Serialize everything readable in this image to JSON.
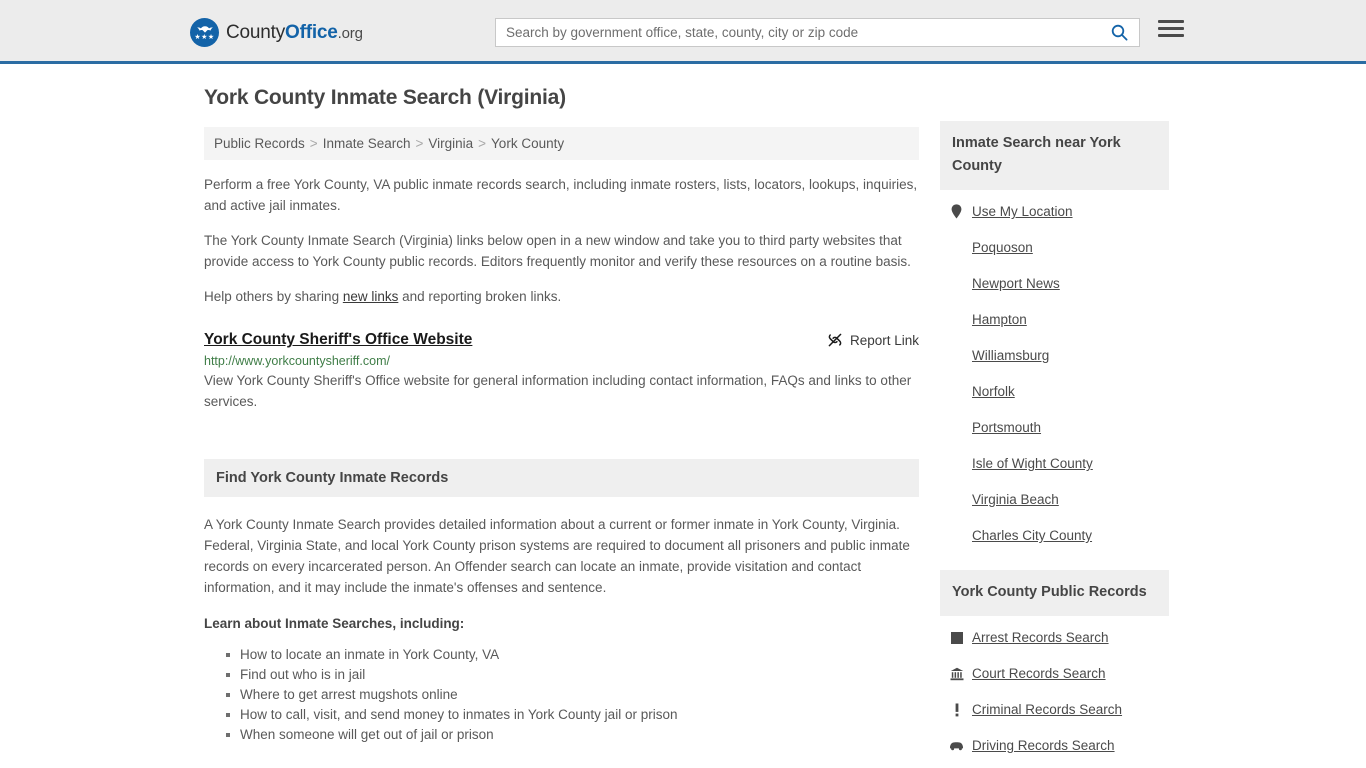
{
  "header": {
    "brand": {
      "part1": "County",
      "part2": "Office",
      "part3": ".org"
    },
    "search": {
      "placeholder": "Search by government office, state, county, city or zip code",
      "value": ""
    },
    "search_icon": "search-icon",
    "menu_icon": "hamburger-menu-icon"
  },
  "page": {
    "title": "York County Inmate Search (Virginia)"
  },
  "breadcrumb": {
    "items": [
      {
        "label": "Public Records"
      },
      {
        "label": "Inmate Search"
      },
      {
        "label": "Virginia"
      },
      {
        "label": "York County"
      }
    ],
    "separator": ">"
  },
  "intro": {
    "p1": "Perform a free York County, VA public inmate records search, including inmate rosters, lists, locators, lookups, inquiries, and active jail inmates.",
    "p2": "The York County Inmate Search (Virginia) links below open in a new window and take you to third party websites that provide access to York County public records. Editors frequently monitor and verify these resources on a routine basis.",
    "p3_before": "Help others by sharing ",
    "p3_link": "new links",
    "p3_after": " and reporting broken links."
  },
  "result": {
    "title": "York County Sheriff's Office Website",
    "url": "http://www.yorkcountysheriff.com/",
    "description": "View York County Sheriff's Office website for general information including contact information, FAQs and links to other services.",
    "report_label": "Report Link",
    "report_icon": "broken-link-icon"
  },
  "section": {
    "heading": "Find York County Inmate Records",
    "body": "A York County Inmate Search provides detailed information about a current or former inmate in York County, Virginia. Federal, Virginia State, and local York County prison systems are required to document all prisoners and public inmate records on every incarcerated person. An Offender search can locate an inmate, provide visitation and contact information, and it may include the inmate's offenses and sentence.",
    "subheading": "Learn about Inmate Searches, including:",
    "bullets": [
      "How to locate an inmate in York County, VA",
      "Find out who is in jail",
      "Where to get arrest mugshots online",
      "How to call, visit, and send money to inmates in York County jail or prison",
      "When someone will get out of jail or prison"
    ]
  },
  "sidebar": {
    "nearby": {
      "heading": "Inmate Search near York County",
      "items": [
        {
          "label": "Use My Location",
          "icon": "map-pin-icon"
        },
        {
          "label": "Poquoson",
          "icon": ""
        },
        {
          "label": "Newport News",
          "icon": ""
        },
        {
          "label": "Hampton",
          "icon": ""
        },
        {
          "label": "Williamsburg",
          "icon": ""
        },
        {
          "label": "Norfolk",
          "icon": ""
        },
        {
          "label": "Portsmouth",
          "icon": ""
        },
        {
          "label": "Isle of Wight County",
          "icon": ""
        },
        {
          "label": "Virginia Beach",
          "icon": ""
        },
        {
          "label": "Charles City County",
          "icon": ""
        }
      ]
    },
    "records": {
      "heading": "York County Public Records",
      "items": [
        {
          "label": "Arrest Records Search",
          "icon": "square-icon"
        },
        {
          "label": "Court Records Search",
          "icon": "courthouse-icon"
        },
        {
          "label": "Criminal Records Search",
          "icon": "exclamation-icon"
        },
        {
          "label": "Driving Records Search",
          "icon": "car-icon"
        }
      ]
    }
  },
  "colors": {
    "header_bg": "#ececec",
    "header_border": "#2b6ca3",
    "brand_blue": "#1363a8",
    "url_green": "#3f7d47",
    "panel_bg": "#efefef",
    "text": "#595959"
  }
}
